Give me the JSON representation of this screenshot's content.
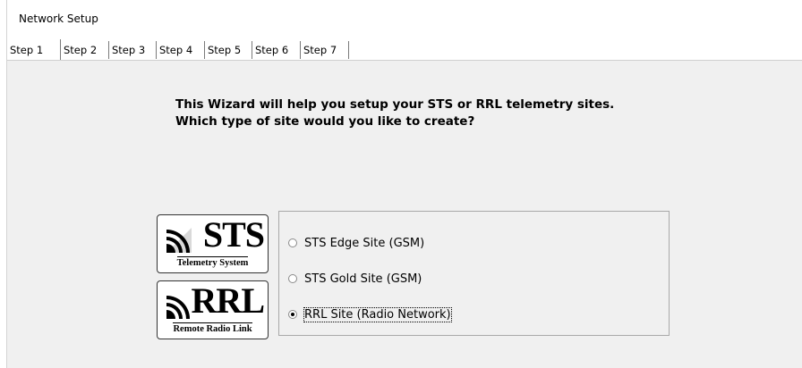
{
  "window": {
    "title": "Network Setup"
  },
  "tabs": [
    {
      "label": "Step 1",
      "active": true
    },
    {
      "label": "Step 2",
      "active": false
    },
    {
      "label": "Step 3",
      "active": false
    },
    {
      "label": "Step 4",
      "active": false
    },
    {
      "label": "Step 5",
      "active": false
    },
    {
      "label": "Step 6",
      "active": false
    },
    {
      "label": "Step 7",
      "active": false
    }
  ],
  "intro": {
    "line1": "This Wizard will help you setup your STS or RRL telemetry sites.",
    "line2": "Which type of site would you like to create?"
  },
  "logos": {
    "sts": {
      "word": "STS",
      "caption": "Telemetry System"
    },
    "rrl": {
      "word": "RRL",
      "caption": "Remote Radio Link"
    }
  },
  "options": [
    {
      "label": "STS Edge Site (GSM)",
      "checked": false
    },
    {
      "label": "STS Gold Site (GSM)",
      "checked": false
    },
    {
      "label": "RRL Site (Radio Network)",
      "checked": true
    }
  ]
}
